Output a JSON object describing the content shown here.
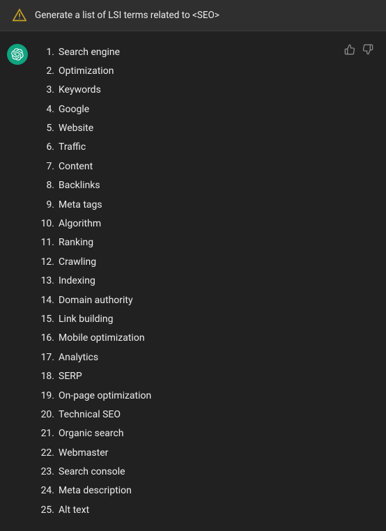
{
  "header": {
    "prompt_text": "Generate a list of LSI terms related to <SEO>"
  },
  "response": {
    "items": [
      {
        "number": "1.",
        "text": "Search engine"
      },
      {
        "number": "2.",
        "text": "Optimization"
      },
      {
        "number": "3.",
        "text": "Keywords"
      },
      {
        "number": "4.",
        "text": "Google"
      },
      {
        "number": "5.",
        "text": "Website"
      },
      {
        "number": "6.",
        "text": "Traffic"
      },
      {
        "number": "7.",
        "text": "Content"
      },
      {
        "number": "8.",
        "text": "Backlinks"
      },
      {
        "number": "9.",
        "text": "Meta tags"
      },
      {
        "number": "10.",
        "text": "Algorithm"
      },
      {
        "number": "11.",
        "text": "Ranking"
      },
      {
        "number": "12.",
        "text": "Crawling"
      },
      {
        "number": "13.",
        "text": "Indexing"
      },
      {
        "number": "14.",
        "text": "Domain authority"
      },
      {
        "number": "15.",
        "text": "Link building"
      },
      {
        "number": "16.",
        "text": "Mobile optimization"
      },
      {
        "number": "17.",
        "text": "Analytics"
      },
      {
        "number": "18.",
        "text": "SERP"
      },
      {
        "number": "19.",
        "text": "On-page optimization"
      },
      {
        "number": "20.",
        "text": "Technical SEO"
      },
      {
        "number": "21.",
        "text": "Organic search"
      },
      {
        "number": "22.",
        "text": "Webmaster"
      },
      {
        "number": "23.",
        "text": "Search console"
      },
      {
        "number": "24.",
        "text": "Meta description"
      },
      {
        "number": "25.",
        "text": "Alt text"
      }
    ]
  },
  "icons": {
    "thumbs_up": "👍",
    "thumbs_down": "👎"
  }
}
